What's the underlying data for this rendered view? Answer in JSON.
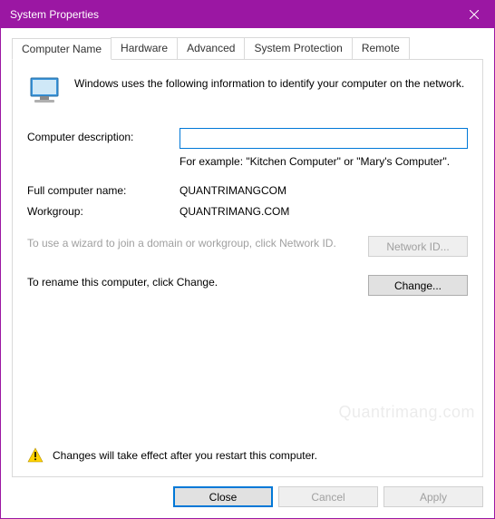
{
  "window": {
    "title": "System Properties"
  },
  "tabs": {
    "computer_name": "Computer Name",
    "hardware": "Hardware",
    "advanced": "Advanced",
    "system_protection": "System Protection",
    "remote": "Remote"
  },
  "intro": "Windows uses the following information to identify your computer on the network.",
  "labels": {
    "description": "Computer description:",
    "full_name": "Full computer name:",
    "workgroup": "Workgroup:"
  },
  "values": {
    "description": "",
    "description_placeholder": "",
    "example_hint": "For example: \"Kitchen Computer\" or \"Mary's Computer\".",
    "full_name": "QUANTRIMANGCOM",
    "workgroup": "QUANTRIMANG.COM"
  },
  "network_id": {
    "text": "To use a wizard to join a domain or workgroup, click Network ID.",
    "button": "Network ID..."
  },
  "change": {
    "text": "To rename this computer, click Change.",
    "button": "Change..."
  },
  "warning": "Changes will take effect after you restart this computer.",
  "footer": {
    "close": "Close",
    "cancel": "Cancel",
    "apply": "Apply"
  },
  "watermark": "Quantrimang.com"
}
